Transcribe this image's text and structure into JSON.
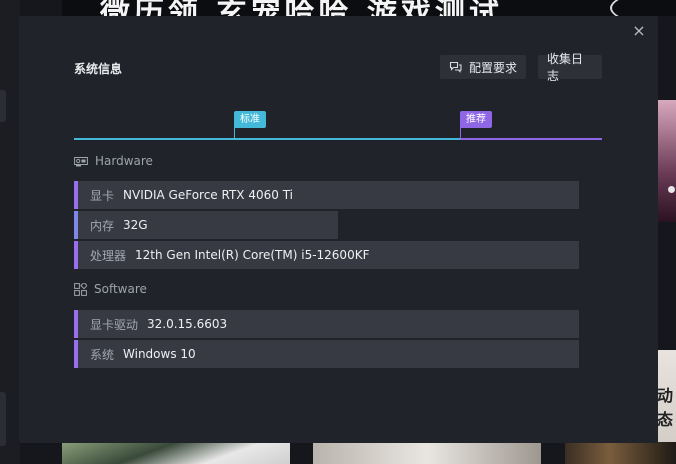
{
  "background": {
    "banner_text": "微历领 玄宠哈哈 游戏测试",
    "side_text": "动态"
  },
  "dialog": {
    "title": "系统信息",
    "close_label": "×",
    "config_button": "配置要求",
    "logs_button": "收集日志",
    "tiers": {
      "standard": "标准",
      "recommended": "推荐"
    },
    "hardware": {
      "heading": "Hardware",
      "rows": [
        {
          "label": "显卡",
          "value": "NVIDIA GeForce RTX 4060 Ti"
        },
        {
          "label": "内存",
          "value": "32G"
        },
        {
          "label": "处理器",
          "value": "12th Gen Intel(R) Core(TM) i5-12600KF"
        }
      ]
    },
    "software": {
      "heading": "Software",
      "rows": [
        {
          "label": "显卡驱动",
          "value": "32.0.15.6603"
        },
        {
          "label": "系统",
          "value": "Windows 10"
        }
      ]
    }
  },
  "colors": {
    "accent_blue": "#43b8d8",
    "accent_purple": "#8f66e6",
    "dialog_bg": "#202329",
    "row_bg": "#373a42"
  }
}
